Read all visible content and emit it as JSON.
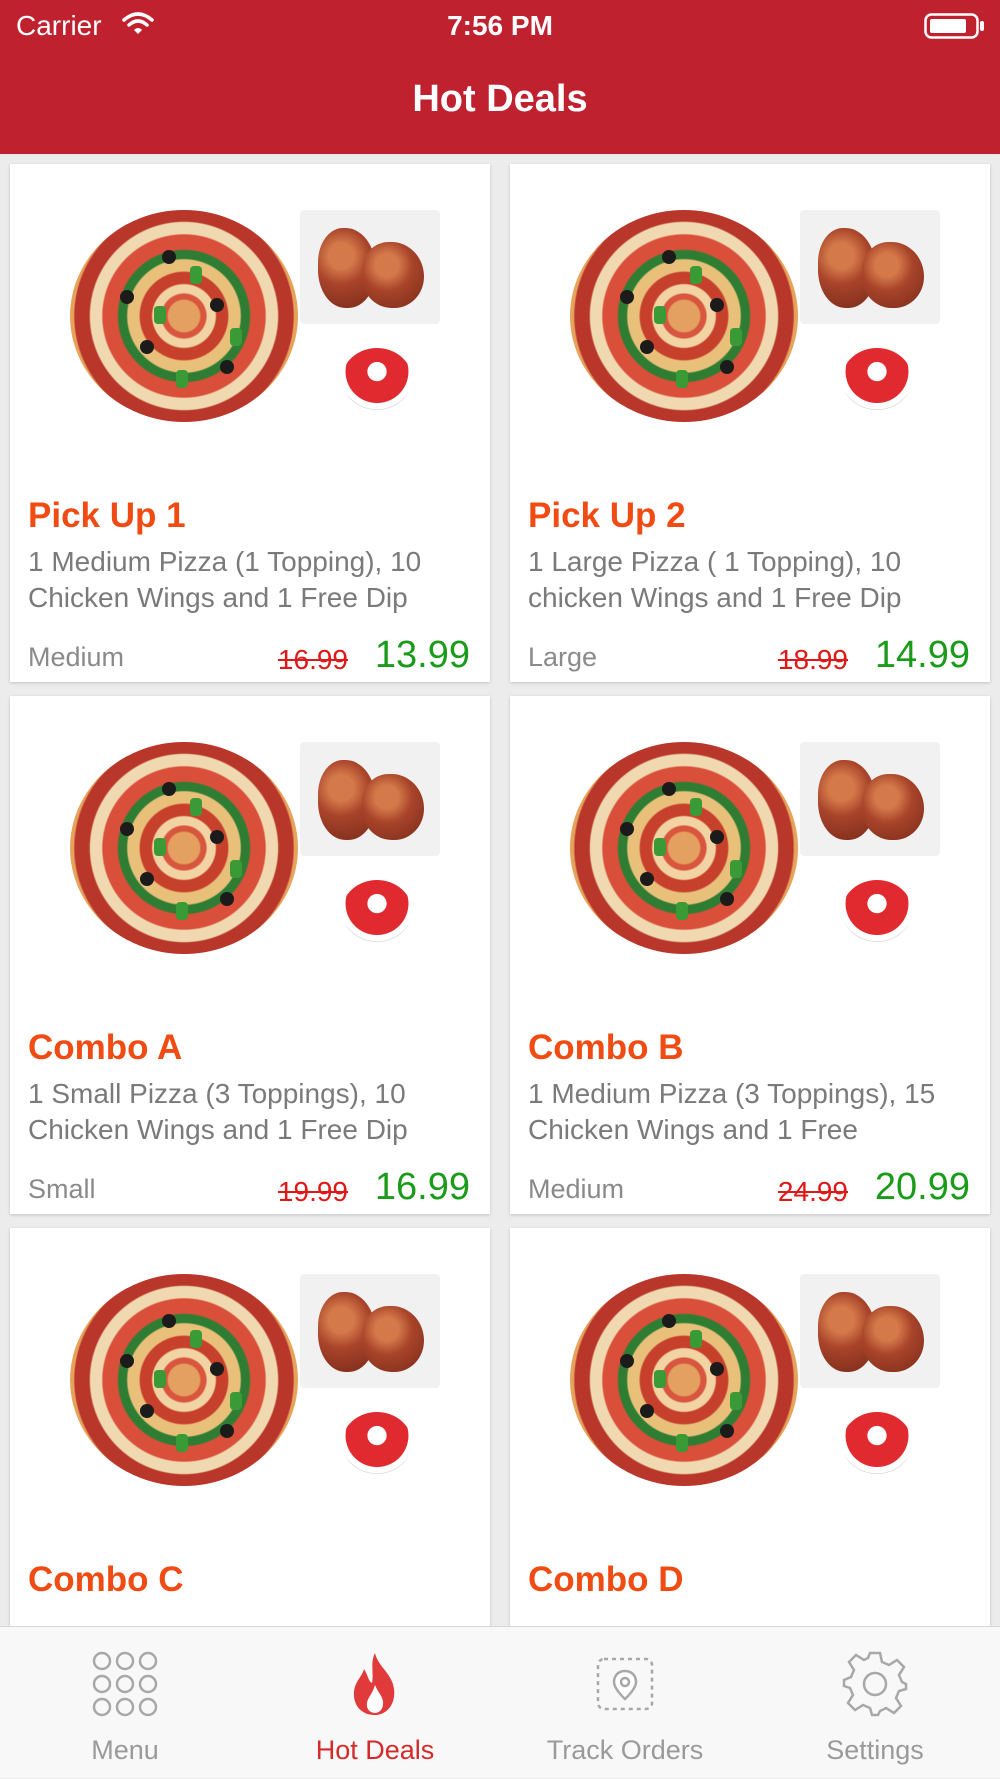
{
  "status_bar": {
    "carrier": "Carrier",
    "time": "7:56 PM"
  },
  "nav": {
    "title": "Hot Deals"
  },
  "deals": [
    {
      "name": "Pick Up 1",
      "desc": "1 Medium Pizza (1 Topping), 10 Chicken Wings and 1 Free Dip",
      "size": "Medium",
      "old_price": "16.99",
      "price": "13.99"
    },
    {
      "name": "Pick Up 2",
      "desc": "1 Large Pizza ( 1 Topping), 10 chicken Wings and 1 Free Dip",
      "size": "Large",
      "old_price": "18.99",
      "price": "14.99"
    },
    {
      "name": "Combo A",
      "desc": "1 Small Pizza (3 Toppings), 10 Chicken Wings and 1 Free Dip",
      "size": "Small",
      "old_price": "19.99",
      "price": "16.99"
    },
    {
      "name": "Combo B",
      "desc": "1 Medium Pizza (3 Toppings), 15 Chicken Wings and 1 Free",
      "size": "Medium",
      "old_price": "24.99",
      "price": "20.99"
    },
    {
      "name": "Combo C",
      "desc": "",
      "size": "",
      "old_price": "",
      "price": ""
    },
    {
      "name": "Combo D",
      "desc": "",
      "size": "",
      "old_price": "",
      "price": ""
    }
  ],
  "tabs": [
    {
      "label": "Menu",
      "icon": "grid-icon",
      "active": false
    },
    {
      "label": "Hot Deals",
      "icon": "flame-icon",
      "active": true
    },
    {
      "label": "Track Orders",
      "icon": "map-pin-icon",
      "active": false
    },
    {
      "label": "Settings",
      "icon": "gear-icon",
      "active": false
    }
  ],
  "colors": {
    "brand": "#c0212f",
    "deal_name": "#f04b12",
    "price": "#1a9b1a",
    "old_price": "#e01818",
    "tab_active": "#d42a2a"
  }
}
